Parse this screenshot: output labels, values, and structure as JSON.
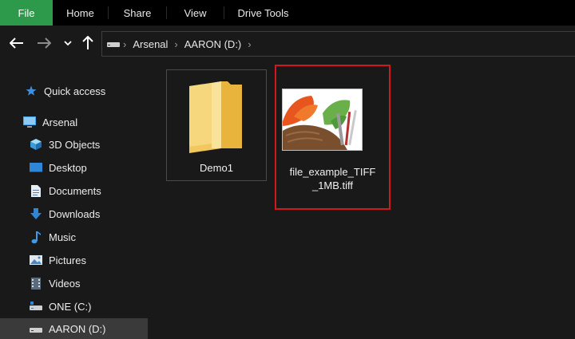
{
  "ribbon": {
    "tabs": [
      "File",
      "Home",
      "Share",
      "View",
      "Drive Tools"
    ],
    "active_color": "#2d9a4b"
  },
  "nav": {
    "back_icon": "arrow-left-icon",
    "forward_icon": "arrow-right-icon",
    "recent_icon": "chevron-down-icon",
    "up_icon": "arrow-up-icon"
  },
  "address": {
    "drive_icon": "drive-icon",
    "crumbs": [
      "Arsenal",
      "AARON (D:)"
    ]
  },
  "sidebar": {
    "items": [
      {
        "label": "Quick access",
        "icon": "star-icon"
      },
      {
        "label": "Arsenal",
        "icon": "computer-icon"
      },
      {
        "label": "3D Objects",
        "icon": "cube-icon"
      },
      {
        "label": "Desktop",
        "icon": "desktop-icon"
      },
      {
        "label": "Documents",
        "icon": "document-icon"
      },
      {
        "label": "Downloads",
        "icon": "download-icon"
      },
      {
        "label": "Music",
        "icon": "music-icon"
      },
      {
        "label": "Pictures",
        "icon": "pictures-icon"
      },
      {
        "label": "Videos",
        "icon": "videos-icon"
      },
      {
        "label": "ONE (C:)",
        "icon": "drive-c-icon"
      },
      {
        "label": "AARON (D:)",
        "icon": "drive-d-icon"
      }
    ],
    "selected": "AARON (D:)"
  },
  "files": {
    "folder": {
      "name": "Demo1",
      "icon": "folder-icon"
    },
    "tiff": {
      "name_line1": "file_example_TIFF",
      "name_line2": "_1MB.tiff",
      "icon": "image-thumbnail",
      "highlight_color": "#d0181e"
    }
  }
}
